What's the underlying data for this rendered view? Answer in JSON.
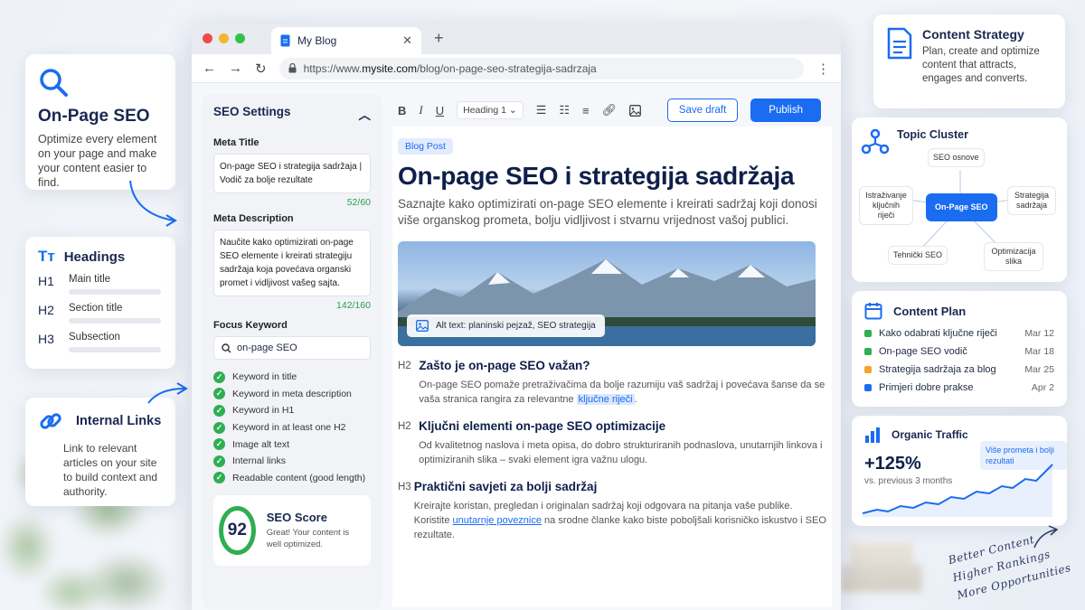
{
  "left": {
    "onpage": {
      "title": "On-Page SEO",
      "desc": "Optimize every element on your page and make your content easier to find."
    },
    "headings": {
      "title": "Headings",
      "items": [
        {
          "tag": "H1",
          "label": "Main title"
        },
        {
          "tag": "H2",
          "label": "Section title"
        },
        {
          "tag": "H3",
          "label": "Subsection"
        }
      ]
    },
    "links": {
      "title": "Internal Links",
      "desc": "Link to relevant articles on your site to build context and authority."
    }
  },
  "browser": {
    "tab_title": "My Blog",
    "url_prefix": "https://www.",
    "url_domain": "mysite.com",
    "url_path": "/blog/on-page-seo-strategija-sadrzaja"
  },
  "seo": {
    "title": "SEO Settings",
    "meta_title_label": "Meta Title",
    "meta_title": "On-page SEO i strategija sadržaja | Vodič za bolje rezultate",
    "meta_title_count": "52/60",
    "meta_desc_label": "Meta Description",
    "meta_desc": "Naučite kako optimizirati on-page SEO elemente i kreirati strategiju sadržaja koja povećava organski promet i vidljivost vašeg sajta.",
    "meta_desc_count": "142/160",
    "focus_label": "Focus Keyword",
    "focus_value": "on-page SEO",
    "checks": [
      "Keyword in title",
      "Keyword in meta description",
      "Keyword in H1",
      "Keyword in at least one H2",
      "Image alt text",
      "Internal links",
      "Readable content (good length)"
    ],
    "score_value": "92",
    "score_title": "SEO Score",
    "score_desc": "Great! Your content is well optimized."
  },
  "editor": {
    "heading_select": "Heading 1",
    "save_draft": "Save draft",
    "publish": "Publish",
    "pill": "Blog Post",
    "h1": "On-page SEO i strategija sadržaja",
    "lead": "Saznajte kako optimizirati on-page SEO elemente i kreirati sadržaj koji donosi više organskog prometa, bolju vidljivost i stvarnu vrijednost vašoj publici.",
    "alt_text": "Alt text: planinski pejzaž, SEO strategija",
    "sections": [
      {
        "tag": "H2",
        "title": "Zašto je on-page SEO važan?",
        "p1": "On-page SEO pomaže pretraživačima da bolje razumiju vaš sadržaj i povećava šanse da se vaša stranica rangira za relevantne ",
        "hl": "ključne riječi",
        "p2": "."
      },
      {
        "tag": "H2",
        "title": "Ključni elementi on-page SEO optimizacije",
        "p1": "Od kvalitetnog naslova i meta opisa, do dobro strukturiranih podnaslova, unutarnjih linkova i optimiziranih slika – svaki element igra važnu ulogu."
      },
      {
        "tag": "H3",
        "title": "Praktični savjeti za bolji sadržaj",
        "p1": "Kreirajte koristan, pregledan i originalan sadržaj koji odgovara na pitanja vaše publike. Koristite ",
        "link": "unutarnje poveznice",
        "p2": " na srodne članke kako biste poboljšali korisničko iskustvo i SEO rezultate."
      }
    ]
  },
  "right": {
    "strategy": {
      "title": "Content Strategy",
      "desc": "Plan, create and optimize content that attracts, engages and converts."
    },
    "cluster": {
      "title": "Topic Cluster",
      "center": "On-Page SEO",
      "nodes": [
        "SEO osnove",
        "Istraživanje ključnih riječi",
        "Strategija sadržaja",
        "Tehnički SEO",
        "Optimizacija slika"
      ]
    },
    "plan": {
      "title": "Content Plan",
      "items": [
        {
          "label": "Kako odabrati ključne riječi",
          "date": "Mar 12",
          "color": "#2fae52"
        },
        {
          "label": "On-page SEO vodič",
          "date": "Mar 18",
          "color": "#2fae52"
        },
        {
          "label": "Strategija sadržaja za blog",
          "date": "Mar 25",
          "color": "#f2a52a"
        },
        {
          "label": "Primjeri dobre prakse",
          "date": "Apr 2",
          "color": "#1a6cf0"
        }
      ]
    },
    "traffic": {
      "title": "Organic Traffic",
      "value": "+125%",
      "sub": "vs. previous 3 months",
      "bubble": "Više prometa i bolji rezultati"
    }
  },
  "handwritten": [
    "Better Content",
    "Higher Rankings",
    "More Opportunities"
  ]
}
